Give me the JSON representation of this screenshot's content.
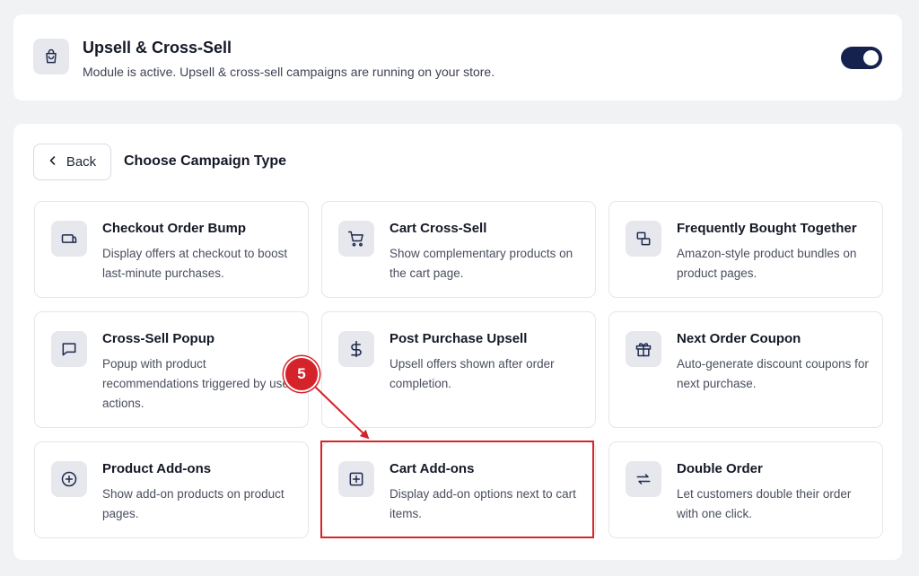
{
  "module": {
    "title": "Upsell & Cross-Sell",
    "description": "Module is active. Upsell & cross-sell campaigns are running on your store.",
    "icon": "shopping-bag-icon",
    "toggle_on": true
  },
  "panel": {
    "back_label": "Back",
    "title": "Choose Campaign Type"
  },
  "campaigns": [
    {
      "title": "Checkout Order Bump",
      "description": "Display offers at checkout to boost last-minute purchases.",
      "icon": "checkout-icon"
    },
    {
      "title": "Cart Cross-Sell",
      "description": "Show complementary products on the cart page.",
      "icon": "cart-icon"
    },
    {
      "title": "Frequently Bought Together",
      "description": "Amazon-style product bundles on product pages.",
      "icon": "bundle-icon"
    },
    {
      "title": "Cross-Sell Popup",
      "description": "Popup with product recommendations triggered by user actions.",
      "icon": "message-icon"
    },
    {
      "title": "Post Purchase Upsell",
      "description": "Upsell offers shown after order completion.",
      "icon": "dollar-icon"
    },
    {
      "title": "Next Order Coupon",
      "description": "Auto-generate discount coupons for next purchase.",
      "icon": "gift-icon"
    },
    {
      "title": "Product Add-ons",
      "description": "Show add-on products on product pages.",
      "icon": "plus-circle-icon"
    },
    {
      "title": "Cart Add-ons",
      "description": "Display add-on options next to cart items.",
      "icon": "plus-square-icon"
    },
    {
      "title": "Double Order",
      "description": "Let customers double their order with one click.",
      "icon": "repeat-icon"
    }
  ],
  "annotation": {
    "step_number": "5",
    "color": "#d5232b"
  },
  "colors": {
    "toggle_bg": "#14224d",
    "icon_bg": "#e6e8ee",
    "page_bg": "#f1f2f4"
  }
}
